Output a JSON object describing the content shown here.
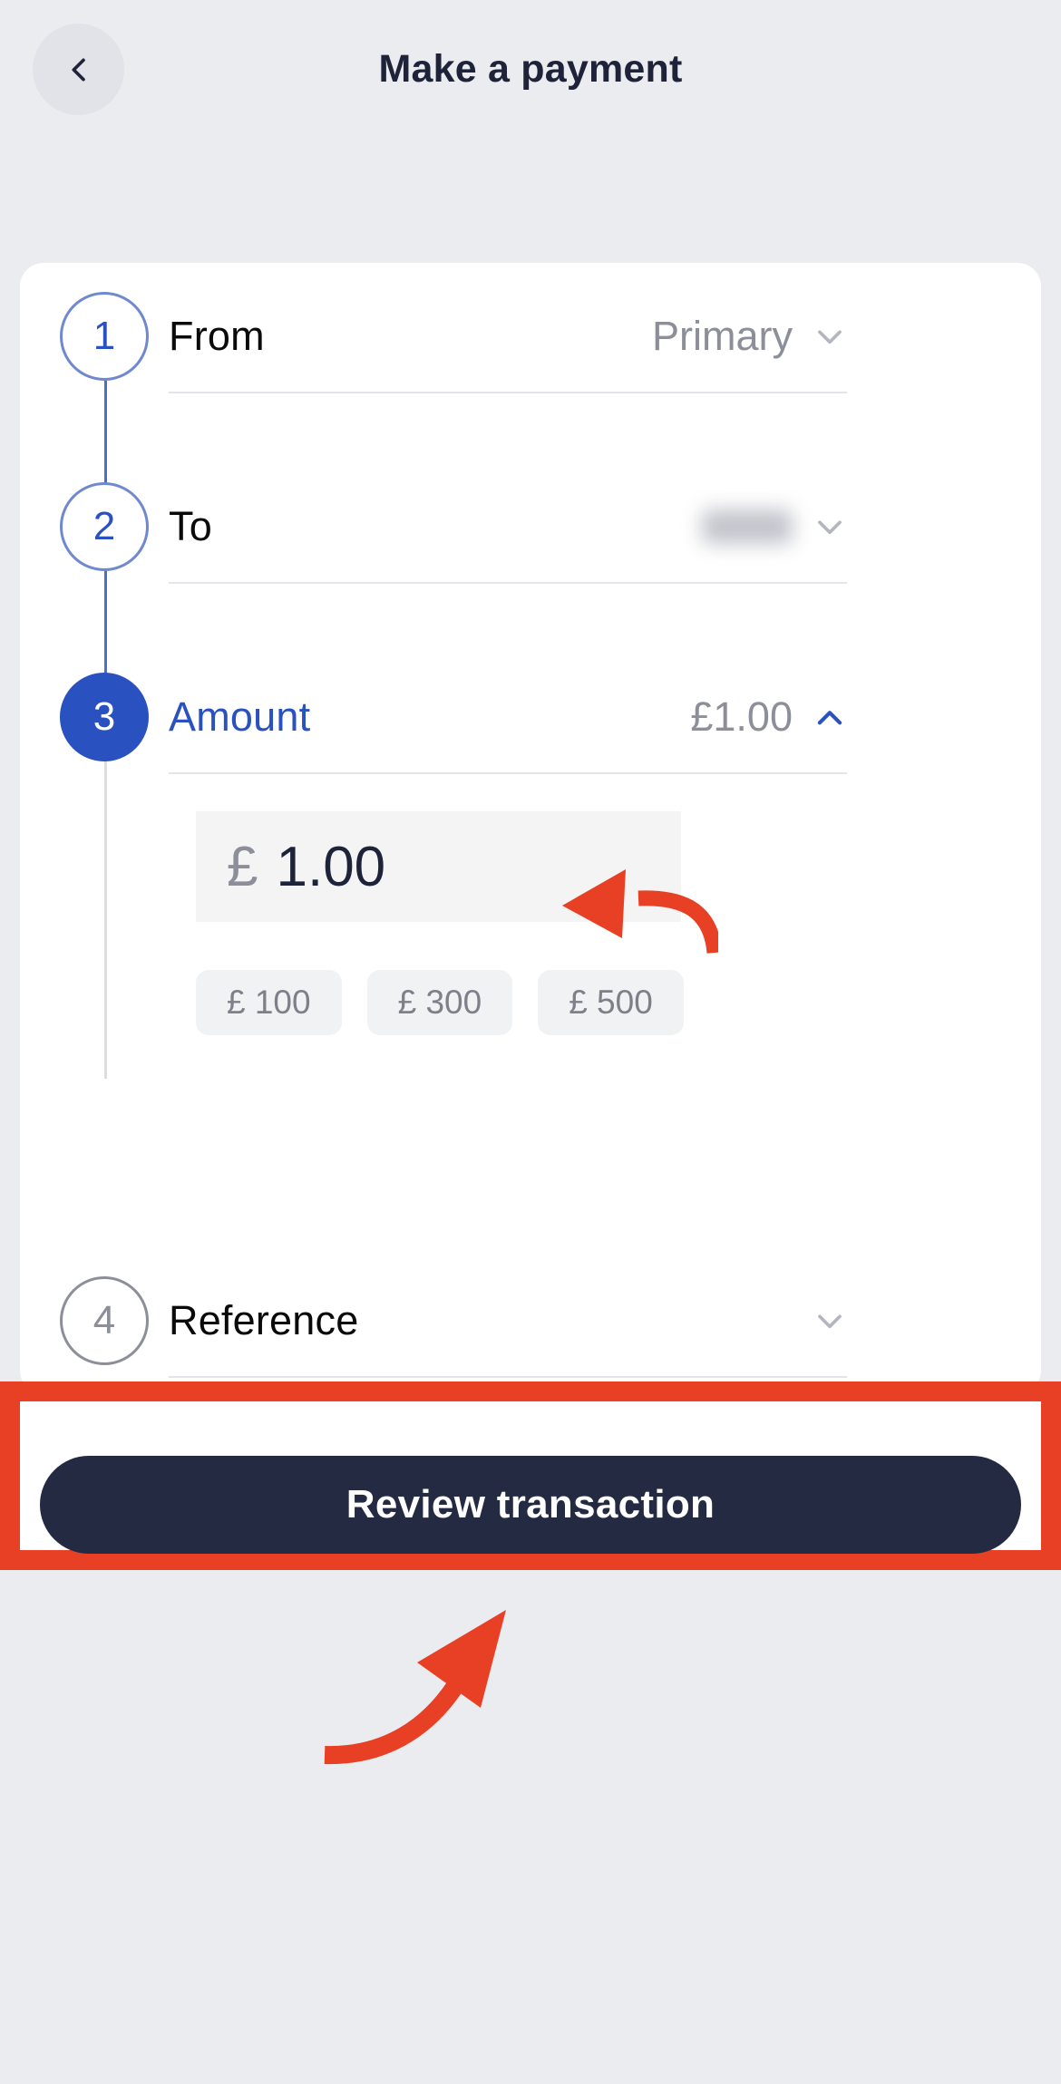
{
  "header": {
    "title": "Make a payment",
    "back_icon": "chevron-left-icon"
  },
  "accent_colors": {
    "blue": "#2a51c0",
    "dark_navy": "#242a42",
    "annotation_red": "#e84025",
    "muted_gray": "#8c8f99",
    "page_background": "#ebecf0",
    "card_background": "#ffffff"
  },
  "steps": [
    {
      "number": "1",
      "label": "From",
      "value": "Primary",
      "state": "pending",
      "chevron": "chevron-down-icon"
    },
    {
      "number": "2",
      "label": "To",
      "value": "",
      "value_redacted": true,
      "state": "pending",
      "chevron": "chevron-down-icon"
    },
    {
      "number": "3",
      "label": "Amount",
      "value": "£1.00",
      "state": "active",
      "chevron": "chevron-up-icon"
    },
    {
      "number": "4",
      "label": "Reference",
      "value": "",
      "state": "inactive",
      "chevron": "chevron-down-icon"
    }
  ],
  "amount_panel": {
    "currency_symbol": "£",
    "value": "1.00",
    "quick_amounts": [
      {
        "label": "£ 100"
      },
      {
        "label": "£ 300"
      },
      {
        "label": "£ 500"
      }
    ]
  },
  "cta": {
    "label": "Review transaction"
  },
  "annotations": [
    {
      "name": "arrow-to-amount-field",
      "color": "#e84025",
      "direction": "left"
    },
    {
      "name": "arrow-to-review-button",
      "color": "#e84025",
      "direction": "up-right"
    }
  ]
}
